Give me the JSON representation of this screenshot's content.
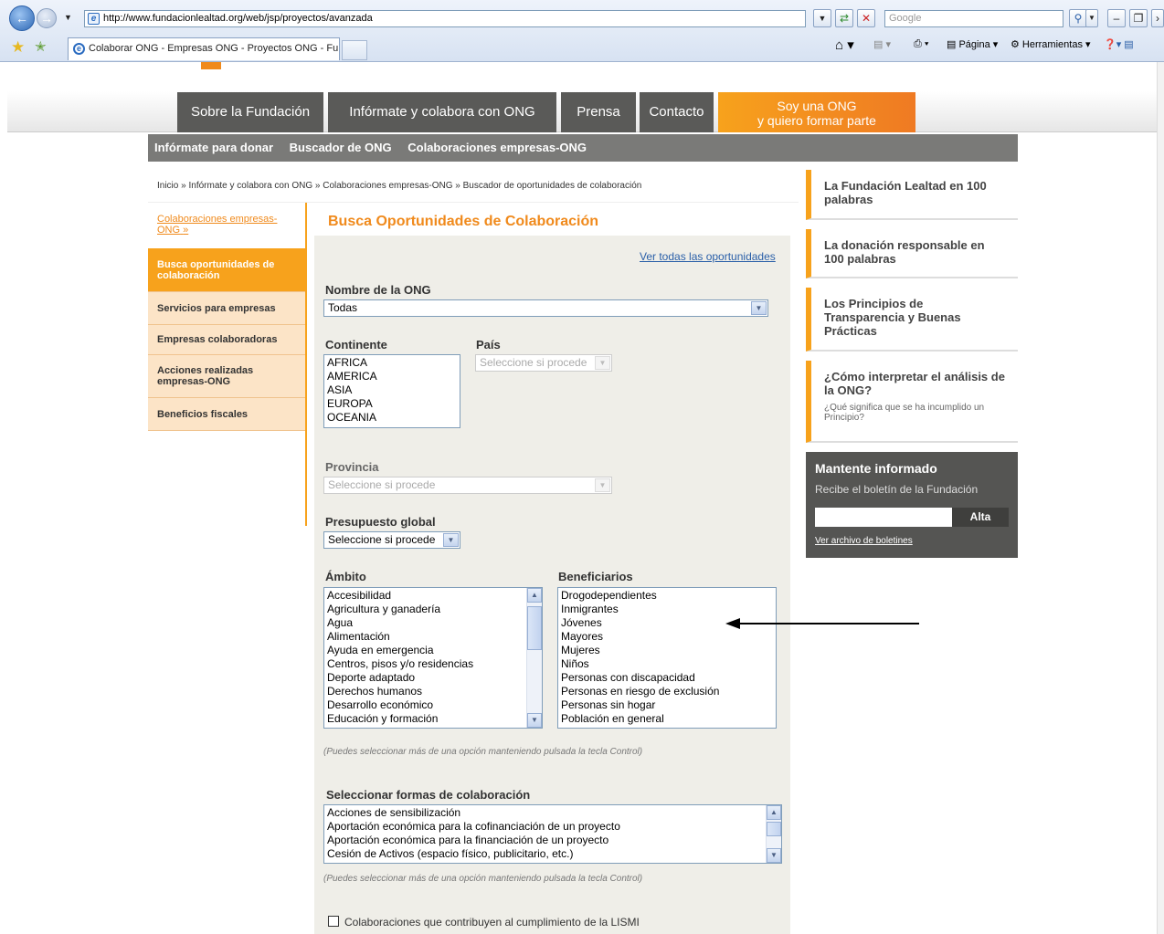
{
  "browser": {
    "url": "http://www.fundacionlealtad.org/web/jsp/proyectos/avanzada",
    "search_placeholder": "Google",
    "tab_title": "Colaborar ONG - Empresas ONG - Proyectos ONG - Fu...",
    "page_menu": "Página",
    "tools_menu": "Herramientas"
  },
  "topnav": {
    "items": [
      "Sobre la Fundación",
      "Infórmate y colabora con ONG",
      "Prensa",
      "Contacto"
    ],
    "ong_line1": "Soy una ONG",
    "ong_line2": "y quiero formar parte"
  },
  "subnav": {
    "items": [
      "Infórmate para donar",
      "Buscador de ONG"
    ],
    "current": "Colaboraciones empresas-ONG"
  },
  "breadcrumb": {
    "items": [
      "Inicio",
      "Infórmate y colabora con ONG",
      "Colaboraciones empresas-ONG"
    ],
    "current": "Buscador de oportunidades de colaboración",
    "sep": "»"
  },
  "sidebar": {
    "head": "Colaboraciones empresas-ONG",
    "head_arrow": "»",
    "items": [
      "Busca oportunidades de colaboración",
      "Servicios para empresas",
      "Empresas colaboradoras",
      "Acciones realizadas empresas-ONG",
      "Beneficios fiscales"
    ]
  },
  "form": {
    "title": "Busca Oportunidades de Colaboración",
    "see_all": "Ver todas las oportunidades",
    "ong_label": "Nombre de la ONG",
    "ong_value": "Todas",
    "continent_label": "Continente",
    "continents": [
      "AFRICA",
      "AMERICA",
      "ASIA",
      "EUROPA",
      "OCEANIA"
    ],
    "country_label": "País",
    "country_value": "Seleccione si procede",
    "province_label": "Provincia",
    "province_value": "Seleccione si procede",
    "budget_label": "Presupuesto global",
    "budget_value": "Seleccione si procede",
    "scope_label": "Ámbito",
    "scope": [
      "Accesibilidad",
      "Agricultura y ganadería",
      "Agua",
      "Alimentación",
      "Ayuda en emergencia",
      "Centros, pisos y/o residencias",
      "Deporte adaptado",
      "Derechos humanos",
      "Desarrollo económico",
      "Educación y formación"
    ],
    "beneficiaries_label": "Beneficiarios",
    "beneficiaries": [
      "Drogodependientes",
      "Inmigrantes",
      "Jóvenes",
      "Mayores",
      "Mujeres",
      "Niños",
      "Personas con discapacidad",
      "Personas en riesgo de exclusión",
      "Personas sin hogar",
      "Población en general"
    ],
    "hint": "(Puedes seleccionar más de una opción manteniendo pulsada la tecla Control)",
    "forms_label": "Seleccionar formas de colaboración",
    "forms": [
      "Acciones de sensibilización",
      "Aportación económica para la cofinanciación de un proyecto",
      "Aportación económica para la financiación de un proyecto",
      "Cesión de Activos (espacio físico, publicitario, etc.)"
    ],
    "hint2": "(Puedes seleccionar más de una opción manteniendo pulsada la tecla Control)",
    "lismi": "Colaboraciones que contribuyen al cumplimiento de la LISMI"
  },
  "right": {
    "boxes": [
      "La Fundación Lealtad en 100 palabras",
      "La donación responsable en 100 palabras",
      "Los Principios de Transparencia y Buenas Prácticas",
      "¿Cómo interpretar el análisis de la ONG?"
    ],
    "box4_sub": "¿Qué significa que se ha incumplido un Principio?",
    "news_title": "Mantente informado",
    "news_text": "Recibe el boletín de la Fundación",
    "news_button": "Alta",
    "news_link": "Ver archivo de boletines"
  },
  "colors": {
    "orange": "#f7a21c",
    "dark": "#5a5a58"
  }
}
